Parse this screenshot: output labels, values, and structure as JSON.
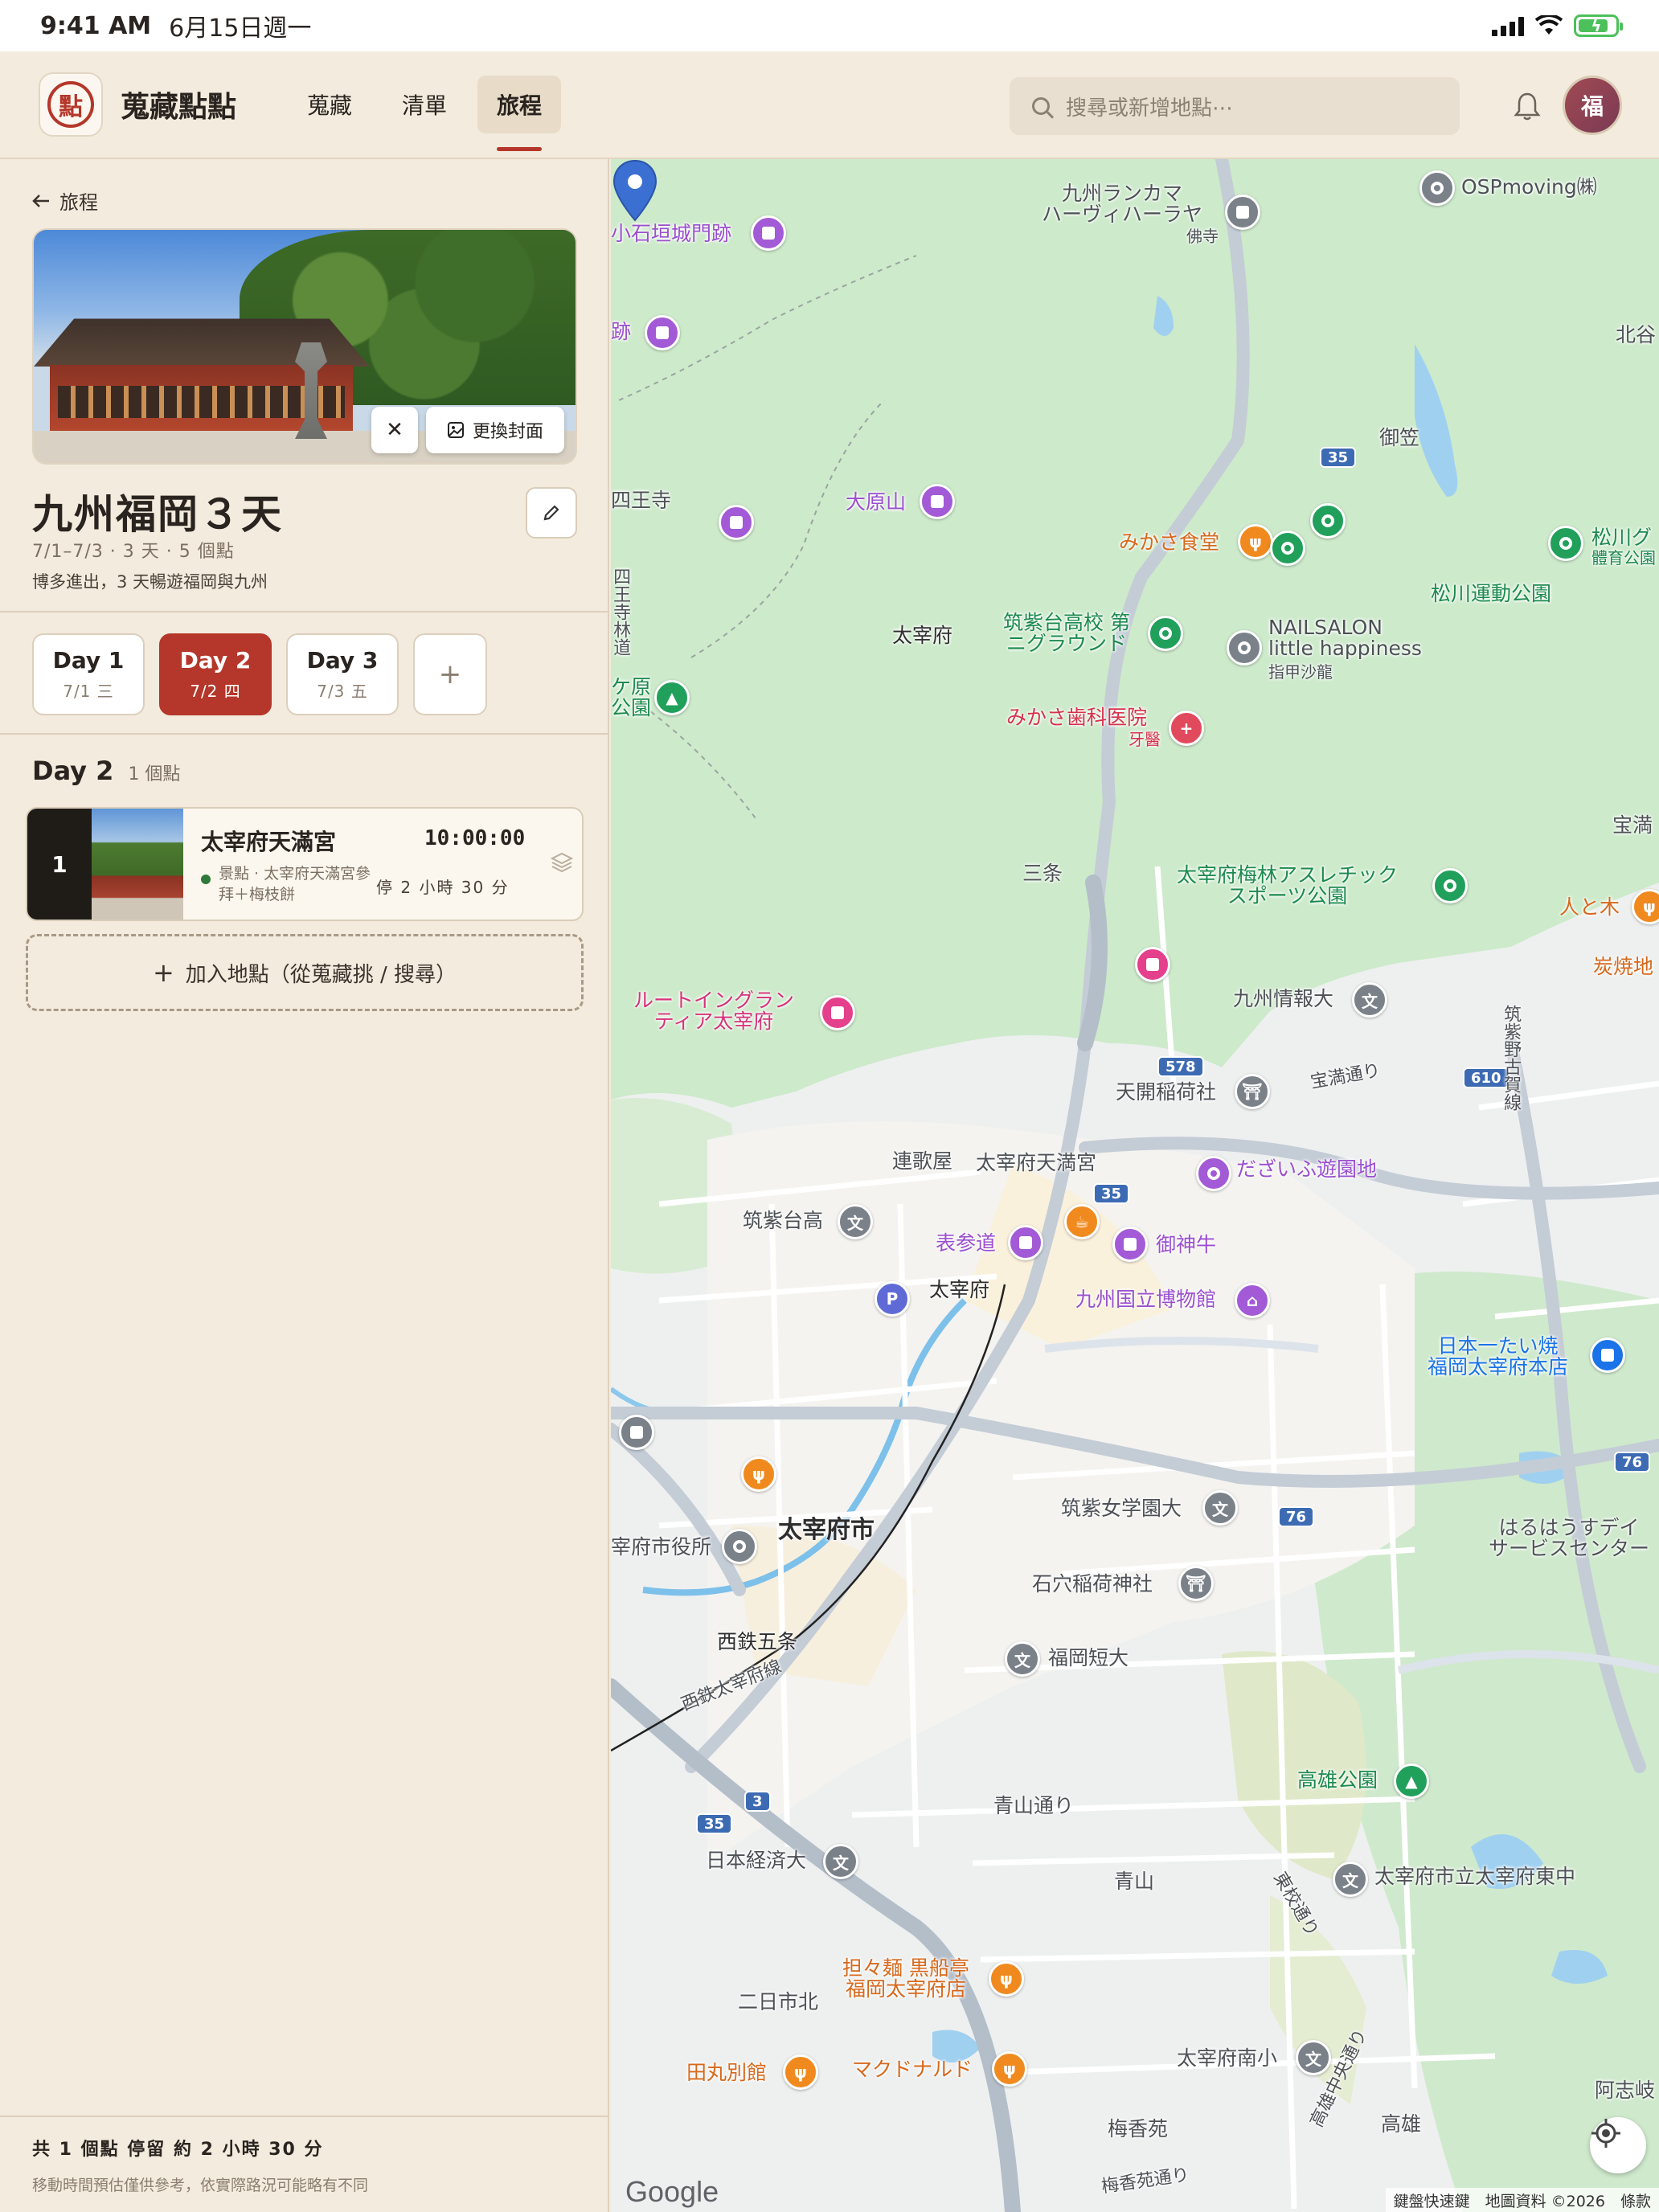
{
  "status_bar": {
    "time": "9:41 AM",
    "date": "6月15日週一"
  },
  "header": {
    "logo_glyph": "點",
    "app_title": "蒐藏點點",
    "tabs": [
      {
        "label": "蒐藏",
        "active": false
      },
      {
        "label": "清單",
        "active": false
      },
      {
        "label": "旅程",
        "active": true
      }
    ],
    "search_placeholder": "搜尋或新增地點⋯",
    "avatar_initial": "福"
  },
  "sidebar": {
    "back_label": "旅程",
    "cover": {
      "change_label": "更換封面",
      "remove_label": "✕"
    },
    "trip": {
      "title": "九州福岡３天",
      "meta": "7/1–7/3 · 3 天 · 5 個點",
      "description": "博多進出，3 天暢遊福岡與九州"
    },
    "days": [
      {
        "label": "Day 1",
        "date": "7/1 三",
        "active": false
      },
      {
        "label": "Day 2",
        "date": "7/2 四",
        "active": true
      },
      {
        "label": "Day 3",
        "date": "7/3 五",
        "active": false
      }
    ],
    "add_day_label": "+",
    "current_day": {
      "title": "Day 2",
      "count": "1 個點"
    },
    "stops": [
      {
        "order": "1",
        "name": "太宰府天滿宮",
        "time": "10:00:00",
        "category": "景點 · 太宰府天滿宮參拜＋梅枝餅",
        "stay": "停 2 小時 30 分"
      }
    ],
    "add_place_label": "加入地點（從蒐藏挑 / 搜尋）",
    "footer": {
      "summary": "共 1 個點  停留 約 2 小時 30 分",
      "note": "移動時間預估僅供參考，依實際路況可能略有不同"
    }
  },
  "map": {
    "labels": {
      "kyushu_lancamer": "九州ランカマ\nハーヴィハーラヤ",
      "butsuji": "佛寺",
      "osp": "OSPmoving㈱",
      "koishigaki": "小石垣城門跡",
      "ato": "跡",
      "kitatani": "北谷",
      "mikasa": "御笠",
      "shiouji": "四王寺",
      "oharayama": "大原山",
      "mikasa_shokudo": "みかさ食堂",
      "matsukawa": "松川グ",
      "taiikukoen": "體育公園",
      "matsukawa_undo": "松川運動公園",
      "shiouji_rindo": "四王寺林道",
      "dazaifu_small": "太宰府",
      "chikushidai_ground": "筑紫台高校 第\nニグラウンド",
      "nailsalon": "NAILSALON\nlittle happiness",
      "shiko_sarong": "指甲沙龍",
      "kehara": "ケ原\n公園",
      "mikasa_dental": "みかさ歯科医院",
      "dental": "牙醫",
      "sanjo": "三条",
      "baibayashi": "太宰府梅林アスレチック\nスポーツ公園",
      "homan": "宝満",
      "hitoto": "人と木",
      "sumiyaki": "炭焼地",
      "route_inn": "ルートイングラン\nティア太宰府",
      "kyushu_joho": "九州情報大",
      "chikushino_road": "筑紫野古賀線",
      "tenkai": "天開稲荷社",
      "homan_dori": "宝満通り",
      "rengaya": "連歌屋",
      "tenmangu": "太宰府天満宮",
      "dazaifu_yuen": "だざいふ遊園地",
      "chikushidai_ko": "筑紫台高",
      "omotesando": "表参道",
      "gojingyu": "御神牛",
      "dazaifu_st": "太宰府",
      "kyushu_museum": "九州国立博物館",
      "nihon_ichi": "日本一たい焼\n福岡太宰府本店",
      "dazaifu_city": "太宰府市",
      "shiyakusho": "宰府市役所",
      "chikushi_jogakuen": "筑紫女学園大",
      "haruhaus": "はるはうすデイ\nサービスセンター",
      "ishiana": "石穴稲荷神社",
      "nishitetsu_gojo": "西鉄五条",
      "nishitetsu_line": "西鉄太宰府線",
      "fukuoka_tanki": "福岡短大",
      "takao_park": "高雄公園",
      "aoyama_dori": "青山通り",
      "nihon_keizai": "日本経済大",
      "dazaifu_higashi": "太宰府市立太宰府東中",
      "aoyama": "青山",
      "higashi_kou": "東校通り",
      "tantan": "担々麺 黒船亭\n福岡太宰府店",
      "futsukaichi": "二日市北",
      "tamaru": "田丸別館",
      "mcd": "マクドナルド",
      "dazaifu_minami": "太宰府南小",
      "akeo": "阿志岐",
      "takao": "高雄",
      "koyou_chuo": "高雄中央通り",
      "umekaen": "梅香苑",
      "umekaen_dori": "梅香苑通り"
    },
    "shields": {
      "r35a": "35",
      "r35b": "35",
      "r35c": "35",
      "r578": "578",
      "r610": "610",
      "r76a": "76",
      "r76b": "76",
      "r3": "3"
    },
    "google": "Google",
    "attribution": "鍵盤快速鍵　地圖資料 ©2026　條款"
  }
}
